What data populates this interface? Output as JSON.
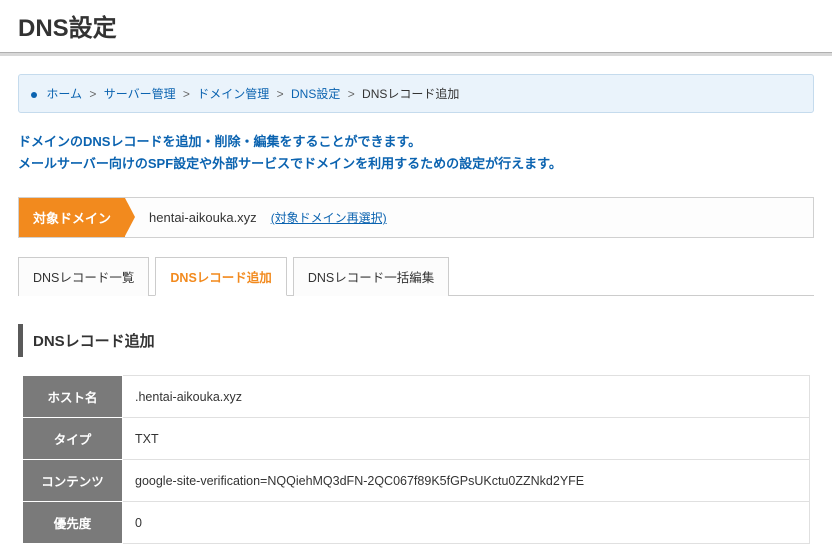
{
  "page_title": "DNS設定",
  "breadcrumb": {
    "items": [
      "ホーム",
      "サーバー管理",
      "ドメイン管理",
      "DNS設定"
    ],
    "current": "DNSレコード追加"
  },
  "description": {
    "line1": "ドメインのDNSレコードを追加・削除・編集をすることができます。",
    "line2": "メールサーバー向けのSPF設定や外部サービスでドメインを利用するための設定が行えます。"
  },
  "domain": {
    "label": "対象ドメイン",
    "value": "hentai-aikouka.xyz",
    "reselect": "(対象ドメイン再選択)"
  },
  "tabs": {
    "list": "DNSレコード一覧",
    "add": "DNSレコード追加",
    "bulk": "DNSレコード一括編集"
  },
  "section_title": "DNSレコード追加",
  "record": {
    "host_label": "ホスト名",
    "host_value": ".hentai-aikouka.xyz",
    "type_label": "タイプ",
    "type_value": "TXT",
    "contents_label": "コンテンツ",
    "contents_value": "google-site-verification=NQQiehMQ3dFN-2QC067f89K5fGPsUKctu0ZZNkd2YFE",
    "priority_label": "優先度",
    "priority_value": "0"
  }
}
